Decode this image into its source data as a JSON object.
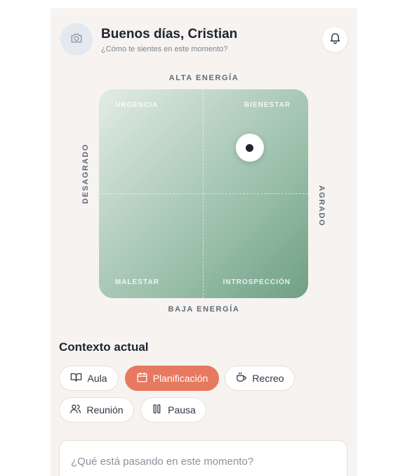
{
  "header": {
    "greeting": "Buenos días, Cristian",
    "subtitle": "¿Cómo te sientes en este momento?",
    "avatar_icon": "camera-icon",
    "notification_icon": "bell-icon"
  },
  "mood_grid": {
    "axis_top": "ALTA ENERGÍA",
    "axis_bottom": "BAJA ENERGÍA",
    "axis_left": "DESAGRADO",
    "axis_right": "AGRADO",
    "quadrants": {
      "top_left": "URGENCIA",
      "top_right": "BIENESTAR",
      "bottom_left": "MALESTAR",
      "bottom_right": "INTROSPECCIÓN"
    },
    "selection": {
      "pleasantness": 0.72,
      "energy": 0.72
    }
  },
  "context": {
    "title": "Contexto actual",
    "chips": [
      {
        "label": "Aula",
        "icon": "book-icon",
        "active": false
      },
      {
        "label": "Planificación",
        "icon": "calendar-icon",
        "active": true
      },
      {
        "label": "Recreo",
        "icon": "coffee-icon",
        "active": false
      },
      {
        "label": "Reunión",
        "icon": "users-icon",
        "active": false
      },
      {
        "label": "Pausa",
        "icon": "pause-icon",
        "active": false
      }
    ]
  },
  "note": {
    "placeholder": "¿Qué está pasando en este momento?"
  },
  "colors": {
    "accent": "#e6795f",
    "grid_green": "#98bea8",
    "text_dark": "#1f2432"
  }
}
